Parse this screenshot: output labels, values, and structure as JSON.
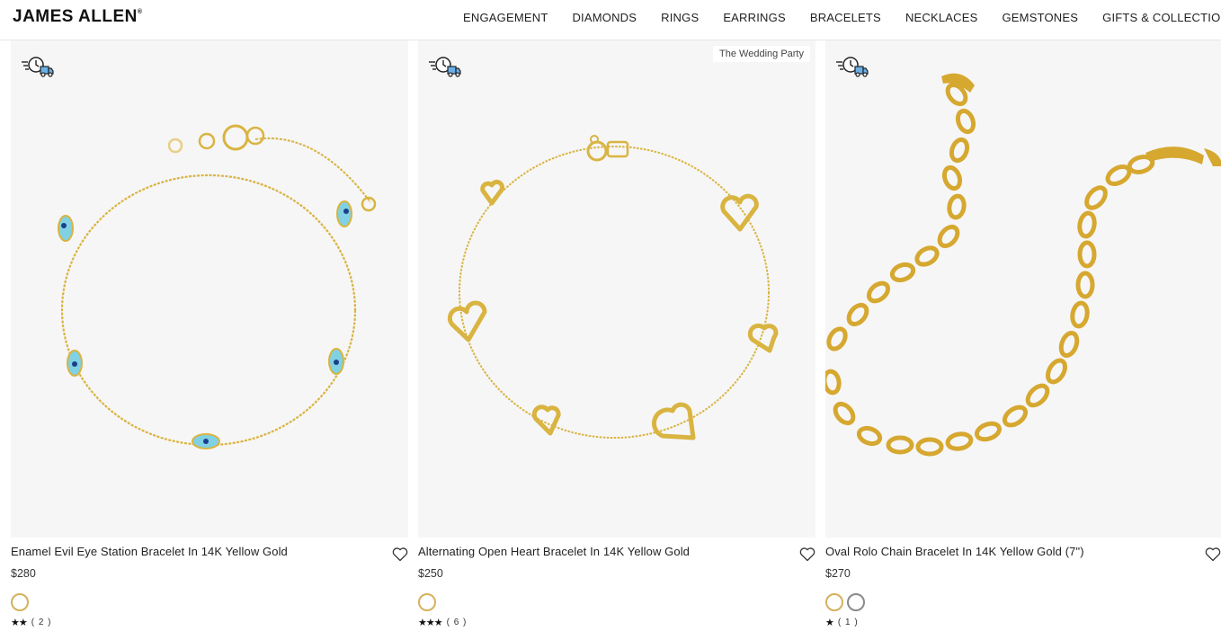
{
  "brand": {
    "name": "JAMES ALLEN",
    "mark": "®"
  },
  "nav": [
    "ENGAGEMENT",
    "DIAMONDS",
    "RINGS",
    "EARRINGS",
    "BRACELETS",
    "NECKLACES",
    "GEMSTONES",
    "GIFTS & COLLECTIONS"
  ],
  "icons": {
    "shipping": "fast-shipping-clock-truck-icon",
    "wishlist": "heart-outline-icon"
  },
  "colors": {
    "gold": "#d4b15c",
    "silver": "#8a8a8a",
    "image_bg": "#f6f6f6"
  },
  "products": [
    {
      "title": "Enamel Evil Eye Station Bracelet In 14K Yellow Gold",
      "price": "$280",
      "tag": "",
      "swatches": [
        "gold"
      ],
      "stars": "★★",
      "rating_value": 2,
      "rating_count": "( 2 )"
    },
    {
      "title": "Alternating Open Heart Bracelet In 14K Yellow Gold",
      "price": "$250",
      "tag": "The Wedding Party",
      "swatches": [
        "gold"
      ],
      "stars": "★★★",
      "rating_value": 3,
      "rating_count": "( 6 )"
    },
    {
      "title": "Oval Rolo Chain Bracelet In 14K Yellow Gold (7\")",
      "price": "$270",
      "tag": "",
      "swatches": [
        "gold",
        "silver"
      ],
      "stars": "★",
      "rating_value": 1,
      "rating_count": "( 1 )"
    }
  ]
}
